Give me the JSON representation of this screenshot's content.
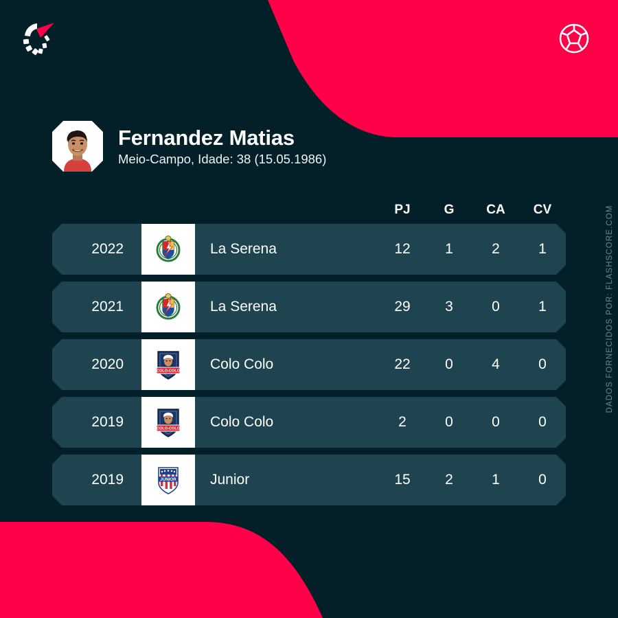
{
  "theme": {
    "background": "#032029",
    "accent_red": "#FF0049",
    "row_background": "#1E4450",
    "text_primary": "#FFFFFF",
    "credit_text": "#6D8790"
  },
  "header": {
    "brand_logo": "flashscore-logo",
    "sport_icon": "soccer-ball-icon"
  },
  "player": {
    "avatar": "player-photo",
    "name": "Fernandez Matias",
    "meta": "Meio-Campo, Idade: 38 (15.05.1986)",
    "position": "Meio-Campo",
    "age_label": "Idade: 38",
    "birthdate": "15.05.1986"
  },
  "stats": {
    "columns": [
      "PJ",
      "G",
      "CA",
      "CV"
    ],
    "rows": [
      {
        "year": "2022",
        "badge": "la-serena-crest",
        "team": "La Serena",
        "pj": "12",
        "g": "1",
        "ca": "2",
        "cv": "1"
      },
      {
        "year": "2021",
        "badge": "la-serena-crest",
        "team": "La Serena",
        "pj": "29",
        "g": "3",
        "ca": "0",
        "cv": "1"
      },
      {
        "year": "2020",
        "badge": "colo-colo-crest",
        "team": "Colo Colo",
        "pj": "22",
        "g": "0",
        "ca": "4",
        "cv": "0"
      },
      {
        "year": "2019",
        "badge": "colo-colo-crest",
        "team": "Colo Colo",
        "pj": "2",
        "g": "0",
        "ca": "0",
        "cv": "0"
      },
      {
        "year": "2019",
        "badge": "junior-crest",
        "team": "Junior",
        "pj": "15",
        "g": "2",
        "ca": "1",
        "cv": "0"
      }
    ]
  },
  "credit": {
    "text": "DADOS FORNECIDOS POR: FLASHSCORE.COM"
  }
}
